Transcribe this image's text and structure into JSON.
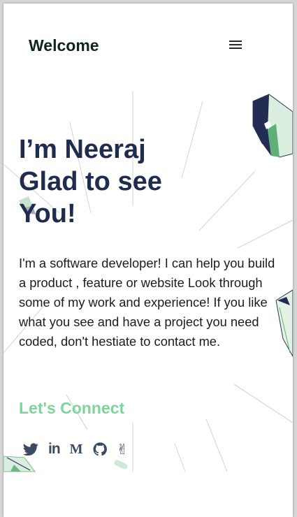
{
  "header": {
    "title": "Welcome",
    "menu_icon": "hamburger-menu-icon"
  },
  "hero": {
    "line1": "I’m Neeraj",
    "line2": "Glad to see",
    "line3": "You!"
  },
  "intro": {
    "text": "I'm a software developer! I can help you build a product , feature or website Look through some of my work and experience! If you like what you see and have a project you need coded, don't hestiate to contact me."
  },
  "connect": {
    "heading": "Let's Connect",
    "links": [
      {
        "icon": "twitter-icon",
        "text": ""
      },
      {
        "icon": "linkedin-icon",
        "text": "in"
      },
      {
        "icon": "medium-icon",
        "text": "M"
      },
      {
        "icon": "github-icon",
        "text": ""
      },
      {
        "icon": "peace-hand-icon",
        "text": "✌"
      }
    ]
  },
  "colors": {
    "heading": "#202c4d",
    "accent": "#7fd49a",
    "text": "#1c1c1c",
    "icons": "#3b4a63"
  }
}
